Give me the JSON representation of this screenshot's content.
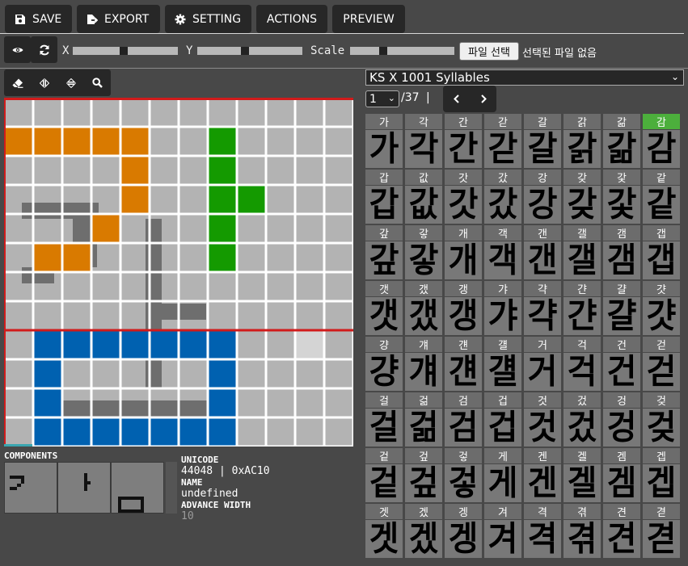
{
  "toolbar": {
    "save_label": "SAVE",
    "export_label": "EXPORT",
    "setting_label": "SETTING",
    "actions_label": "ACTIONS",
    "preview_label": "PREVIEW"
  },
  "transform": {
    "x_label": "X",
    "y_label": "Y",
    "scale_label": "Scale",
    "x_value": 0.48,
    "y_value": 0.45,
    "scale_value": 0.3
  },
  "file": {
    "button_label": "파일 선택",
    "status_text": "선택된 파일 없음"
  },
  "editor": {
    "grid_size": 12,
    "colors": {
      "background": "#b3b3b3",
      "orange": "#d97a00",
      "green": "#149a00",
      "blue": "#0061b0",
      "highlight": "#d4d4d4",
      "guide": "#d11b1b",
      "gridline": "#ffffff",
      "ghost": "#6e6e6e"
    },
    "orange_cells": [
      [
        1,
        0
      ],
      [
        1,
        1
      ],
      [
        1,
        2
      ],
      [
        1,
        3
      ],
      [
        1,
        4
      ],
      [
        2,
        4
      ],
      [
        3,
        4
      ],
      [
        4,
        3
      ],
      [
        5,
        1
      ],
      [
        5,
        2
      ]
    ],
    "green_cells": [
      [
        1,
        7
      ],
      [
        2,
        7
      ],
      [
        3,
        7
      ],
      [
        3,
        8
      ],
      [
        4,
        7
      ],
      [
        5,
        7
      ]
    ],
    "blue_cells": [
      [
        8,
        1
      ],
      [
        8,
        2
      ],
      [
        8,
        3
      ],
      [
        8,
        4
      ],
      [
        8,
        5
      ],
      [
        8,
        6
      ],
      [
        8,
        7
      ],
      [
        9,
        1
      ],
      [
        9,
        7
      ],
      [
        10,
        1
      ],
      [
        10,
        7
      ],
      [
        11,
        1
      ],
      [
        11,
        2
      ],
      [
        11,
        3
      ],
      [
        11,
        4
      ],
      [
        11,
        5
      ],
      [
        11,
        6
      ],
      [
        11,
        7
      ]
    ],
    "highlight_cells": [
      [
        8,
        10
      ]
    ]
  },
  "components": {
    "title": "COMPONENTS",
    "items": [
      "ㄱ",
      "ㅏ",
      "ㅁ"
    ]
  },
  "info": {
    "unicode_label": "UNICODE",
    "unicode_value": "44048 | 0xAC10",
    "name_label": "NAME",
    "name_value": "undefined",
    "advance_label": "ADVANCE WIDTH",
    "advance_value": "10"
  },
  "charset": {
    "selected": "KS X 1001 Syllables",
    "page": "1",
    "page_total": "/37",
    "separator": "|"
  },
  "glyphs": [
    "가",
    "각",
    "간",
    "갇",
    "갈",
    "갉",
    "갊",
    "감",
    "갑",
    "값",
    "갓",
    "갔",
    "강",
    "갖",
    "갗",
    "같",
    "갚",
    "갛",
    "개",
    "객",
    "갠",
    "갤",
    "갬",
    "갭",
    "갯",
    "갰",
    "갱",
    "갸",
    "갹",
    "갼",
    "걀",
    "걋",
    "걍",
    "걔",
    "걘",
    "걜",
    "거",
    "걱",
    "건",
    "걷",
    "걸",
    "걺",
    "검",
    "겁",
    "것",
    "겄",
    "겅",
    "겆",
    "겉",
    "겊",
    "겋",
    "게",
    "겐",
    "겔",
    "겜",
    "겝",
    "겟",
    "겠",
    "겡",
    "겨",
    "격",
    "겪",
    "견",
    "겯"
  ],
  "selected_glyph": "감"
}
